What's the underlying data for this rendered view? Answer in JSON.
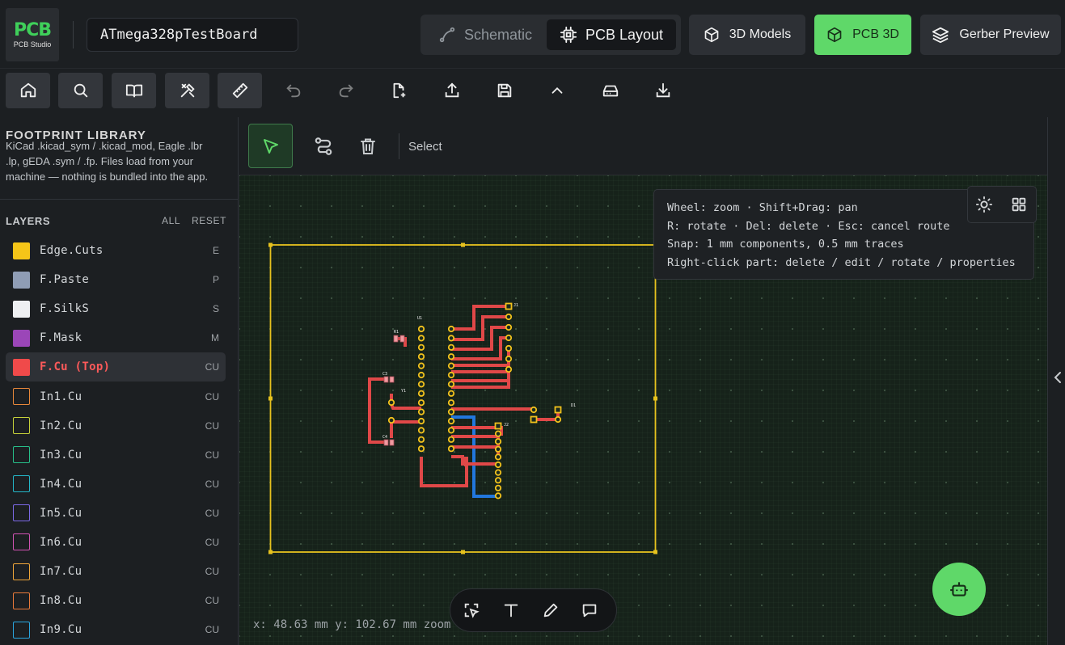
{
  "app": {
    "logo_main": "PCB",
    "logo_sub": "PCB Studio",
    "project_name": "ATmega328pTestBoard"
  },
  "view_switch": {
    "schematic_label": "Schematic",
    "pcb_layout_label": "PCB Layout",
    "active": "PCB Layout"
  },
  "top_buttons": {
    "models3d_label": "3D Models",
    "pcb3d_label": "PCB 3D",
    "gerber_label": "Gerber Preview"
  },
  "toolbar": {
    "icons": [
      "home-icon",
      "search-icon",
      "book-icon",
      "tools-icon",
      "ruler-icon",
      "undo-icon",
      "redo-icon",
      "new-file-icon",
      "upload-icon",
      "save-icon",
      "chevron-up-icon",
      "drive-icon",
      "download-icon"
    ]
  },
  "sidebar": {
    "footprint_title": "FOOTPRINT LIBRARY",
    "footprint_desc_line0": "KiCad .kicad_sym / .kicad_mod, Eagle .lbr",
    "footprint_desc_line1": ".lp, gEDA .sym / .fp. Files load from your",
    "footprint_desc_line2": "machine — nothing is bundled into the app.",
    "layers_title": "LAYERS",
    "layers_all": "ALL",
    "layers_reset": "RESET",
    "layers": [
      {
        "name": "Edge.Cuts",
        "key": "E",
        "color": "#f5c518",
        "filled": true
      },
      {
        "name": "F.Paste",
        "key": "P",
        "color": "#8f9db5",
        "filled": true
      },
      {
        "name": "F.SilkS",
        "key": "S",
        "color": "#eef0f2",
        "filled": true
      },
      {
        "name": "F.Mask",
        "key": "M",
        "color": "#9b46b8",
        "filled": true
      },
      {
        "name": "F.Cu (Top)",
        "key": "CU",
        "color": "#f04a4a",
        "filled": true
      },
      {
        "name": "In1.Cu",
        "key": "CU",
        "color": "#e8883a",
        "filled": false
      },
      {
        "name": "In2.Cu",
        "key": "CU",
        "color": "#c7d23a",
        "filled": false
      },
      {
        "name": "In3.Cu",
        "key": "CU",
        "color": "#27c08a",
        "filled": false
      },
      {
        "name": "In4.Cu",
        "key": "CU",
        "color": "#24b7c9",
        "filled": false
      },
      {
        "name": "In5.Cu",
        "key": "CU",
        "color": "#7c69e6",
        "filled": false
      },
      {
        "name": "In6.Cu",
        "key": "CU",
        "color": "#d253b3",
        "filled": false
      },
      {
        "name": "In7.Cu",
        "key": "CU",
        "color": "#f0a63a",
        "filled": false
      },
      {
        "name": "In8.Cu",
        "key": "CU",
        "color": "#ea7a3a",
        "filled": false
      },
      {
        "name": "In9.Cu",
        "key": "CU",
        "color": "#2aa6e0",
        "filled": false
      }
    ]
  },
  "canvas_toolbar": {
    "mode_label": "Select"
  },
  "canvas": {
    "help_line1": "Wheel: zoom · Shift+Drag: pan",
    "help_line2": "R: rotate · Del: delete · Esc: cancel route",
    "help_line3": "Snap: 1 mm components, 0.5 mm traces",
    "help_line4": "Right-click part: delete / edit / rotate / properties",
    "coord_text": "x: 48.63 mm y: 102.67 mm zoom",
    "refs": [
      "U1",
      "R1",
      "C3",
      "C4",
      "J1",
      "J2",
      "D1",
      "Y1"
    ]
  },
  "colors": {
    "accent": "#5fd869",
    "top_copper": "#e04848",
    "bottom_copper": "#2277dd",
    "edge_cuts": "#e6c21e",
    "pad": "#f2c21c"
  }
}
